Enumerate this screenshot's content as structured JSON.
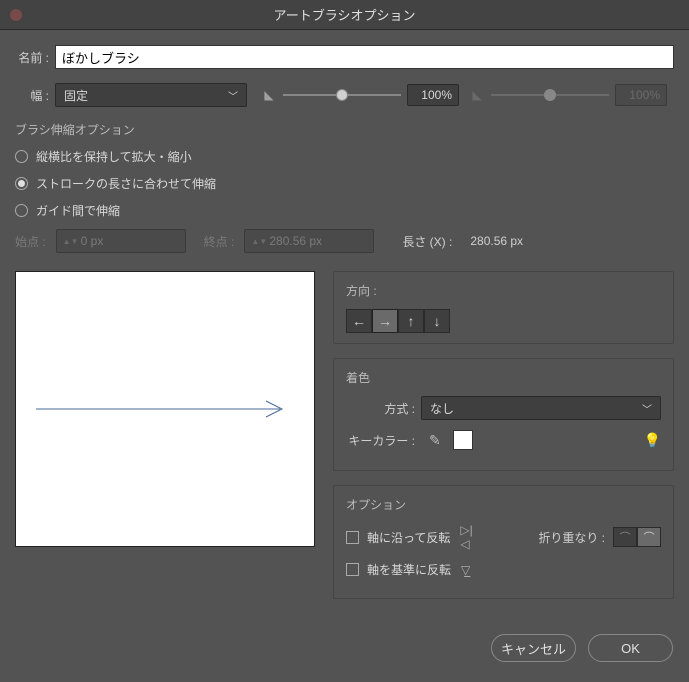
{
  "titlebar": {
    "title": "アートブラシオプション"
  },
  "name": {
    "label": "名前 :",
    "value": "ぼかしブラシ"
  },
  "width": {
    "label": "幅 :",
    "mode": "固定",
    "slider1_value": "100%",
    "slider2_value": "100%"
  },
  "stretch": {
    "title": "ブラシ伸縮オプション",
    "opt1": "縦横比を保持して拡大・縮小",
    "opt2": "ストロークの長さに合わせて伸縮",
    "opt3": "ガイド間で伸縮",
    "start_label": "始点 :",
    "start_value": "0 px",
    "end_label": "終点 :",
    "end_value": "280.56 px",
    "length_label": "長さ (X) :",
    "length_value": "280.56 px"
  },
  "direction": {
    "title": "方向 :"
  },
  "colorize": {
    "title": "着色",
    "method_label": "方式 :",
    "method_value": "なし",
    "keycolor_label": "キーカラー :"
  },
  "options": {
    "title": "オプション",
    "flip_along": "軸に沿って反転",
    "flip_across": "軸を基準に反転",
    "overlap_label": "折り重なり :"
  },
  "footer": {
    "cancel": "キャンセル",
    "ok": "OK"
  }
}
